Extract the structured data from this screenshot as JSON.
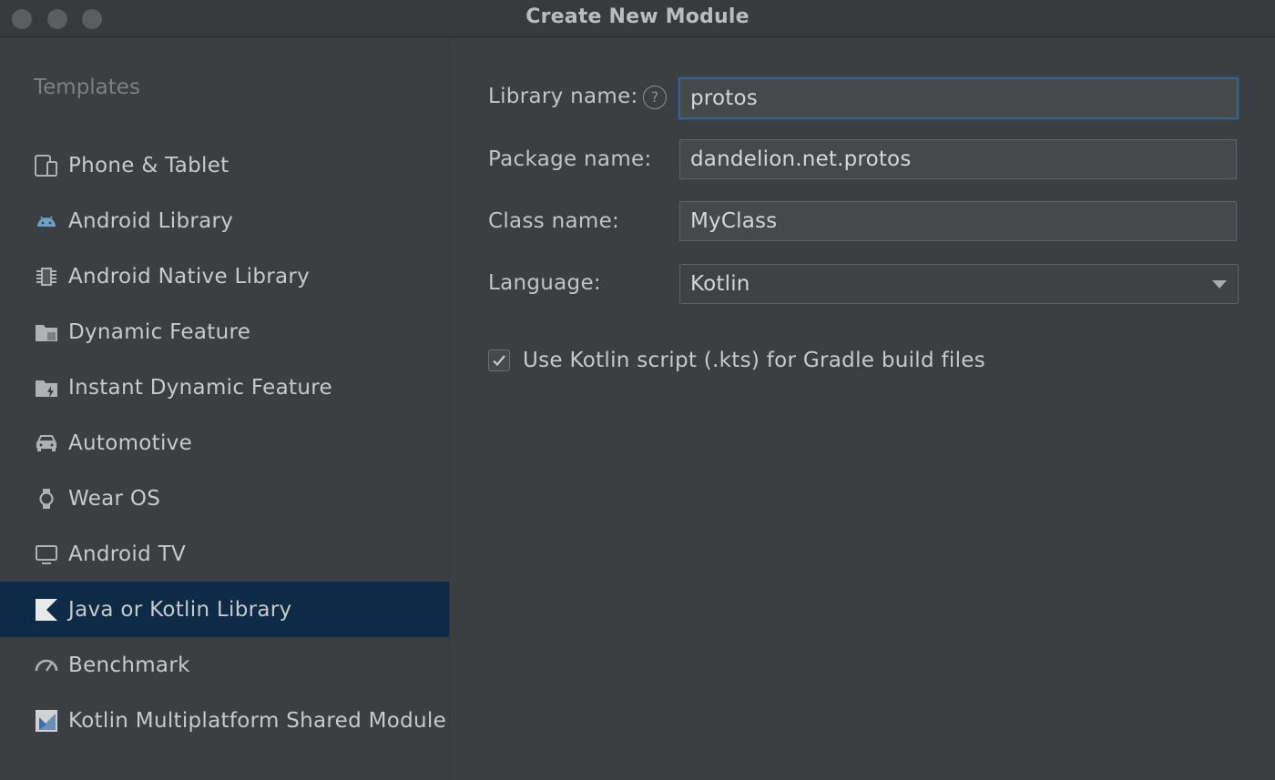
{
  "window": {
    "title": "Create New Module"
  },
  "sidebar": {
    "header": "Templates",
    "selected_index": 9,
    "items": [
      {
        "label": "Phone & Tablet",
        "icon": "phone-tablet-icon"
      },
      {
        "label": "Android Library",
        "icon": "android-icon"
      },
      {
        "label": "Android Native Library",
        "icon": "native-chip-icon"
      },
      {
        "label": "Dynamic Feature",
        "icon": "feature-folder-icon"
      },
      {
        "label": "Instant Dynamic Feature",
        "icon": "instant-feature-folder-icon"
      },
      {
        "label": "Automotive",
        "icon": "car-icon"
      },
      {
        "label": "Wear OS",
        "icon": "watch-icon"
      },
      {
        "label": "Android TV",
        "icon": "tv-icon"
      },
      {
        "label": "Java or Kotlin Library",
        "icon": "kotlin-icon"
      },
      {
        "label": "Benchmark",
        "icon": "gauge-icon"
      },
      {
        "label": "Kotlin Multiplatform Shared Module",
        "icon": "kotlin-multiplatform-icon"
      }
    ]
  },
  "form": {
    "library_name": {
      "label": "Library name:",
      "value": "protos"
    },
    "package_name": {
      "label": "Package name:",
      "value": "dandelion.net.protos"
    },
    "class_name": {
      "label": "Class name:",
      "value": "MyClass"
    },
    "language": {
      "label": "Language:",
      "value": "Kotlin"
    },
    "use_kts": {
      "label": "Use Kotlin script (.kts) for Gradle build files",
      "checked": true
    }
  },
  "help_icon_glyph": "?",
  "colors": {
    "selection": "#0d2a47",
    "background": "#3c3f41",
    "focus_border": "#3d6185"
  }
}
